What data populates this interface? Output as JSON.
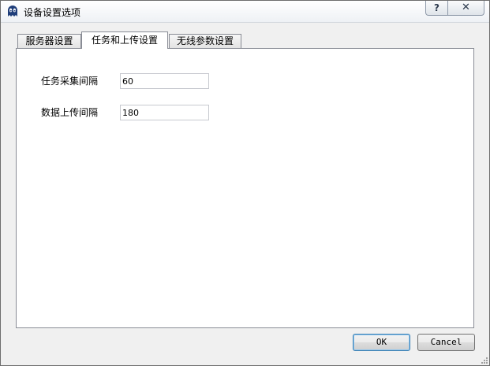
{
  "window": {
    "title": "设备设置选项",
    "help_glyph": "?",
    "close_glyph": "✕"
  },
  "tabs": [
    {
      "label": "服务器设置",
      "active": false
    },
    {
      "label": "任务和上传设置",
      "active": true
    },
    {
      "label": "无线参数设置",
      "active": false
    }
  ],
  "form": {
    "collect_interval": {
      "label": "任务采集间隔",
      "value": "60"
    },
    "upload_interval": {
      "label": "数据上传间隔",
      "value": "180"
    }
  },
  "buttons": {
    "ok_label": "OK",
    "cancel_label": "Cancel"
  },
  "colors": {
    "window_bg": "#f0f0f0",
    "panel_bg": "#ffffff",
    "default_button_border": "#3c7fb1",
    "app_icon": "#1f3e7a"
  },
  "icons": {
    "app": "ghost-app-icon",
    "help": "question-mark-icon",
    "close": "close-icon",
    "grip": "resize-grip-icon"
  }
}
